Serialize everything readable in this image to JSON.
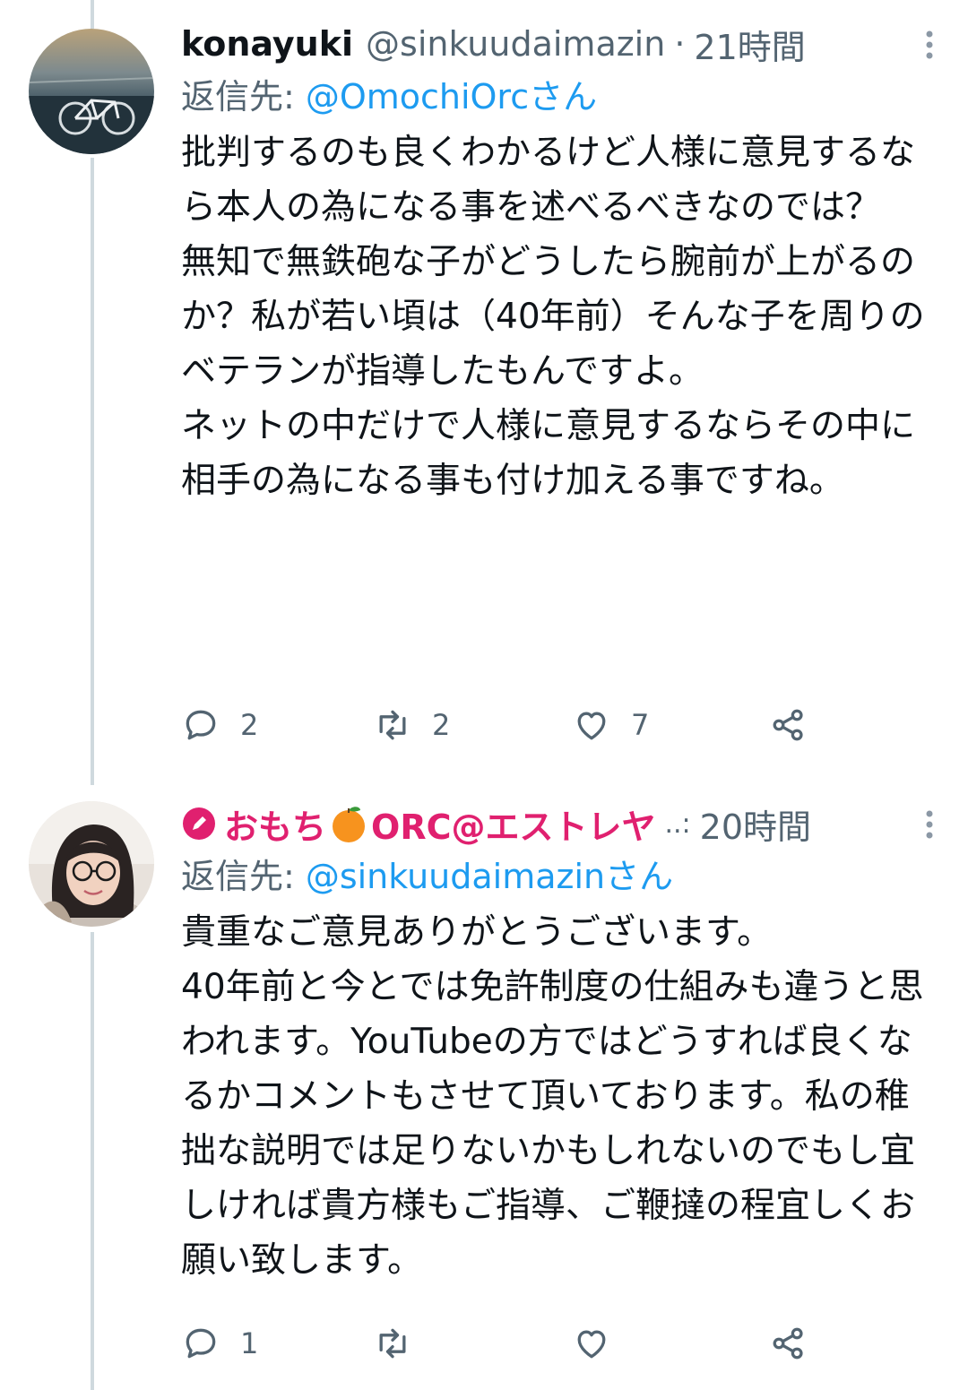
{
  "tweets": [
    {
      "name": "konayuki",
      "handle": "@sinkuudaimazin",
      "separator": "·",
      "time": "21時間",
      "reply_label": "返信先:",
      "reply_target": "@OmochiOrcさん",
      "body": "批判するのも良くわかるけど人様に意見するなら本人の為になる事を述べるべきなのでは？\n無知で無鉄砲な子がどうしたら腕前が上がるのか？私が若い頃は（40年前）そんな子を周りのベテランが指導したもんですよ。\nネットの中だけで人様に意見するならその中に相手の為になる事も付け加える事ですね。",
      "replies": "2",
      "retweets": "2",
      "likes": "7"
    },
    {
      "name_prefix": "おもち",
      "name_suffix": "ORC@エストレヤ",
      "ellipsis": "..:",
      "time": "20時間",
      "reply_label": "返信先:",
      "reply_target": "@sinkuudaimazinさん",
      "body": "貴重なご意見ありがとうございます。\n40年前と今とでは免許制度の仕組みも違うと思われます。YouTubeの方ではどうすれば良くなるかコメントもさせて頂いております。私の稚拙な説明では足りないかもしれないのでもし宜しければ貴方様もご指導、ご鞭撻の程宜しくお願い致します。",
      "replies": "1",
      "retweets": "",
      "likes": ""
    }
  ],
  "icons": {
    "reply": "reply-icon",
    "retweet": "retweet-icon",
    "like": "heart-icon",
    "share": "share-icon",
    "more": "more-vertical-icon",
    "orange": "orange-emoji-icon",
    "pen": "pen-badge-icon"
  },
  "colors": {
    "name2": "#e0206f",
    "link": "#1d9bf0",
    "muted": "#536471"
  }
}
